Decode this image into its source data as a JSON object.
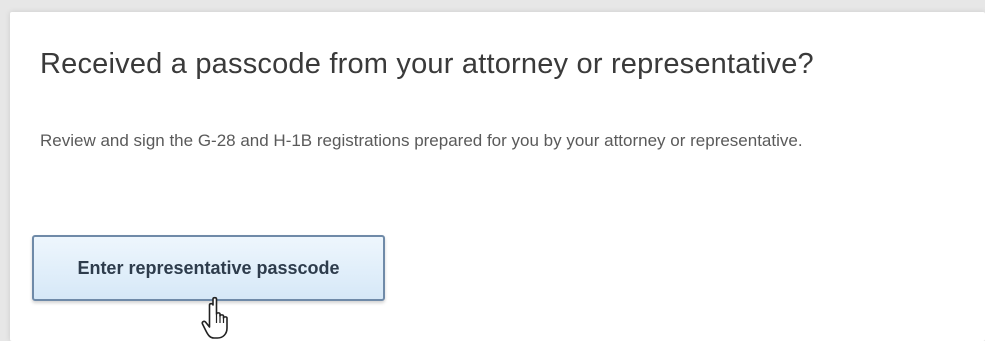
{
  "panel": {
    "title": "Received a passcode from your attorney or representative?",
    "description": "Review and sign the G-28 and H-1B registrations prepared for you by your attorney or representative.",
    "button_label": "Enter representative passcode"
  },
  "cursor": {
    "icon": "hand-pointer-icon"
  },
  "colors": {
    "background": "#e7e7e7",
    "card": "#ffffff",
    "button_border": "#6f8aa8",
    "button_fill": "#d6e8f7"
  }
}
